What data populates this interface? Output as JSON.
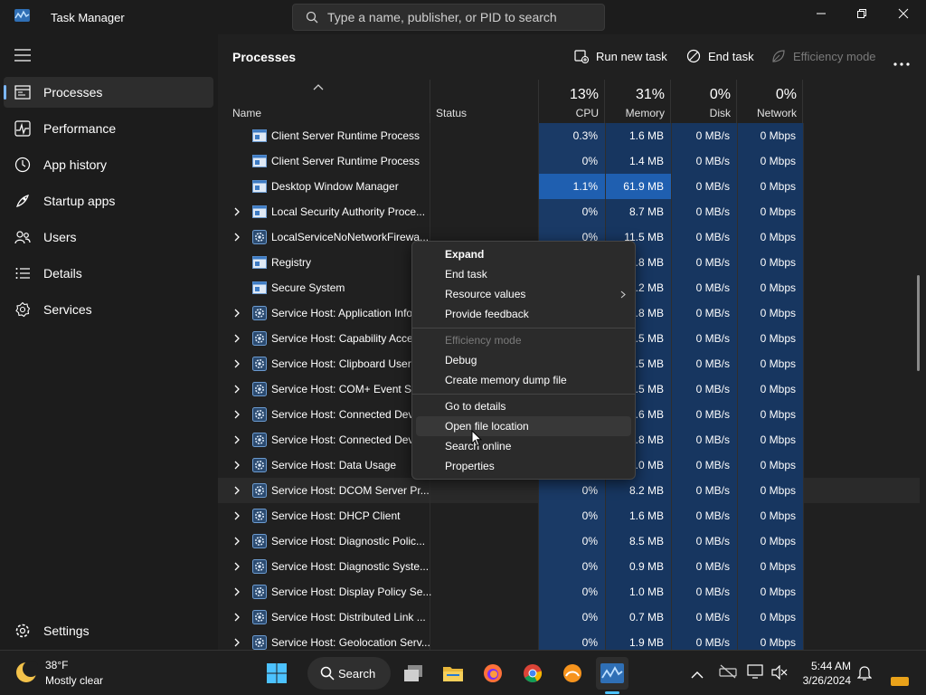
{
  "window": {
    "title": "Task Manager"
  },
  "search": {
    "placeholder": "Type a name, publisher, or PID to search"
  },
  "nav": {
    "items": [
      {
        "label": "Processes",
        "icon": "processes-icon",
        "active": true
      },
      {
        "label": "Performance",
        "icon": "performance-icon"
      },
      {
        "label": "App history",
        "icon": "app-history-icon"
      },
      {
        "label": "Startup apps",
        "icon": "startup-apps-icon"
      },
      {
        "label": "Users",
        "icon": "users-icon"
      },
      {
        "label": "Details",
        "icon": "details-icon"
      },
      {
        "label": "Services",
        "icon": "services-icon"
      }
    ],
    "settings_label": "Settings"
  },
  "page": {
    "title": "Processes"
  },
  "toolbar": {
    "run_new_task": "Run new task",
    "end_task": "End task",
    "efficiency_mode": "Efficiency mode"
  },
  "columns": {
    "name": "Name",
    "status": "Status",
    "cpu": {
      "percent": "13%",
      "label": "CPU"
    },
    "memory": {
      "percent": "31%",
      "label": "Memory"
    },
    "disk": {
      "percent": "0%",
      "label": "Disk"
    },
    "network": {
      "percent": "0%",
      "label": "Network"
    }
  },
  "processes": [
    {
      "name": "Client Server Runtime Process",
      "expandable": false,
      "icon": "window-icon",
      "cpu": "0.3%",
      "memory": "1.6 MB",
      "disk": "0 MB/s",
      "network": "0 Mbps"
    },
    {
      "name": "Client Server Runtime Process",
      "expandable": false,
      "icon": "window-icon",
      "cpu": "0%",
      "memory": "1.4 MB",
      "disk": "0 MB/s",
      "network": "0 Mbps"
    },
    {
      "name": "Desktop Window Manager",
      "expandable": false,
      "icon": "window-icon",
      "cpu": "1.1%",
      "memory": "61.9 MB",
      "disk": "0 MB/s",
      "network": "0 Mbps",
      "highlight": true
    },
    {
      "name": "Local Security Authority Proce...",
      "expandable": true,
      "icon": "window-icon",
      "cpu": "0%",
      "memory": "8.7 MB",
      "disk": "0 MB/s",
      "network": "0 Mbps"
    },
    {
      "name": "LocalServiceNoNetworkFirewa...",
      "expandable": true,
      "icon": "gear-icon",
      "cpu": "0%",
      "memory": "11.5 MB",
      "disk": "0 MB/s",
      "network": "0 Mbps"
    },
    {
      "name": "Registry",
      "expandable": false,
      "icon": "window-icon",
      "cpu": "",
      "memory": ".8 MB",
      "disk": "0 MB/s",
      "network": "0 Mbps"
    },
    {
      "name": "Secure System",
      "expandable": false,
      "icon": "window-icon",
      "cpu": "",
      "memory": ".2 MB",
      "disk": "0 MB/s",
      "network": "0 Mbps"
    },
    {
      "name": "Service Host: Application Info",
      "expandable": true,
      "icon": "gear-icon",
      "cpu": "",
      "memory": ".8 MB",
      "disk": "0 MB/s",
      "network": "0 Mbps"
    },
    {
      "name": "Service Host: Capability Acces",
      "expandable": true,
      "icon": "gear-icon",
      "cpu": "",
      "memory": ".5 MB",
      "disk": "0 MB/s",
      "network": "0 Mbps"
    },
    {
      "name": "Service Host: Clipboard User S",
      "expandable": true,
      "icon": "gear-icon",
      "cpu": "",
      "memory": ".5 MB",
      "disk": "0 MB/s",
      "network": "0 Mbps"
    },
    {
      "name": "Service Host: COM+ Event Sy",
      "expandable": true,
      "icon": "gear-icon",
      "cpu": "",
      "memory": ".5 MB",
      "disk": "0 MB/s",
      "network": "0 Mbps"
    },
    {
      "name": "Service Host: Connected Devi",
      "expandable": true,
      "icon": "gear-icon",
      "cpu": "",
      "memory": ".6 MB",
      "disk": "0 MB/s",
      "network": "0 Mbps"
    },
    {
      "name": "Service Host: Connected Devi",
      "expandable": true,
      "icon": "gear-icon",
      "cpu": "",
      "memory": ".8 MB",
      "disk": "0 MB/s",
      "network": "0 Mbps"
    },
    {
      "name": "Service Host: Data Usage",
      "expandable": true,
      "icon": "gear-icon",
      "cpu": "",
      "memory": ".0 MB",
      "disk": "0 MB/s",
      "network": "0 Mbps"
    },
    {
      "name": "Service Host: DCOM Server Pr...",
      "expandable": true,
      "icon": "gear-icon",
      "cpu": "0%",
      "memory": "8.2 MB",
      "disk": "0 MB/s",
      "network": "0 Mbps",
      "selected": true
    },
    {
      "name": "Service Host: DHCP Client",
      "expandable": true,
      "icon": "gear-icon",
      "cpu": "0%",
      "memory": "1.6 MB",
      "disk": "0 MB/s",
      "network": "0 Mbps"
    },
    {
      "name": "Service Host: Diagnostic Polic...",
      "expandable": true,
      "icon": "gear-icon",
      "cpu": "0%",
      "memory": "8.5 MB",
      "disk": "0 MB/s",
      "network": "0 Mbps"
    },
    {
      "name": "Service Host: Diagnostic Syste...",
      "expandable": true,
      "icon": "gear-icon",
      "cpu": "0%",
      "memory": "0.9 MB",
      "disk": "0 MB/s",
      "network": "0 Mbps"
    },
    {
      "name": "Service Host: Display Policy Se...",
      "expandable": true,
      "icon": "gear-icon",
      "cpu": "0%",
      "memory": "1.0 MB",
      "disk": "0 MB/s",
      "network": "0 Mbps"
    },
    {
      "name": "Service Host: Distributed Link ...",
      "expandable": true,
      "icon": "gear-icon",
      "cpu": "0%",
      "memory": "0.7 MB",
      "disk": "0 MB/s",
      "network": "0 Mbps"
    },
    {
      "name": "Service Host: Geolocation Serv...",
      "expandable": true,
      "icon": "gear-icon",
      "cpu": "0%",
      "memory": "1.9 MB",
      "disk": "0 MB/s",
      "network": "0 Mbps"
    }
  ],
  "context_menu": {
    "groups": [
      [
        {
          "label": "Expand",
          "bold": true
        },
        {
          "label": "End task"
        },
        {
          "label": "Resource values",
          "submenu": true
        },
        {
          "label": "Provide feedback"
        }
      ],
      [
        {
          "label": "Efficiency mode",
          "disabled": true
        },
        {
          "label": "Debug"
        },
        {
          "label": "Create memory dump file"
        }
      ],
      [
        {
          "label": "Go to details"
        },
        {
          "label": "Open file location",
          "hover": true
        },
        {
          "label": "Search online"
        },
        {
          "label": "Properties"
        }
      ]
    ]
  },
  "taskbar": {
    "weather": {
      "temp": "38°F",
      "desc": "Mostly clear"
    },
    "search_label": "Search",
    "apps": [
      "windows-start-icon",
      "task-view-icon",
      "file-explorer-icon",
      "firefox-icon",
      "chrome-icon",
      "app-icon",
      "task-manager-icon"
    ],
    "clock": {
      "time": "5:44 AM",
      "date": "3/26/2024"
    }
  },
  "colors": {
    "accent": "#7cb7ff",
    "cpu_heat": "#1a3a66",
    "cpu_heat_high": "#1f5fb0"
  }
}
